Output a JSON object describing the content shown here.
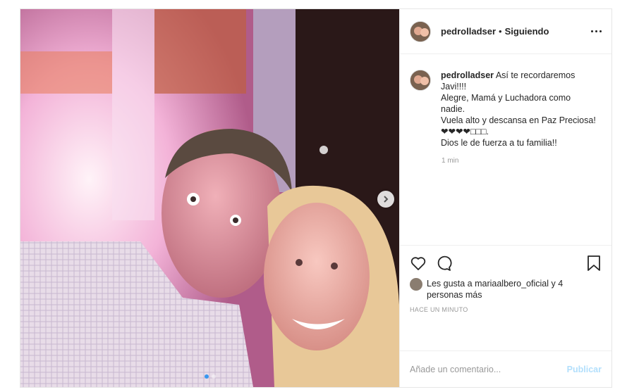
{
  "post": {
    "username": "pedrolladser",
    "separator": "•",
    "follow_status": "Siguiendo",
    "more_icon": "more-options-icon"
  },
  "caption": {
    "username": "pedrolladser",
    "lines": [
      "Así te recordaremos Javi!!!!",
      "Alegre, Mamá y Luchadora como nadie.",
      "Vuela alto y descansa en Paz Preciosa!",
      "❤❤❤❤□□□.",
      "Dios le de fuerza a tu familia!!"
    ],
    "time": "1 min"
  },
  "actions": {
    "like_icon": "heart-icon",
    "comment_icon": "comment-icon",
    "save_icon": "bookmark-icon"
  },
  "likes": {
    "text": "Les gusta a mariaalbero_oficial y 4 personas más"
  },
  "timestamp": "HACE UN MINUTO",
  "comment_box": {
    "placeholder": "Añade un comentario...",
    "publish_label": "Publicar"
  },
  "carousel": {
    "total": 2,
    "active": 0
  },
  "colors": {
    "accent": "#3897f0",
    "publish_disabled": "#b2dffc",
    "muted": "#999999"
  }
}
